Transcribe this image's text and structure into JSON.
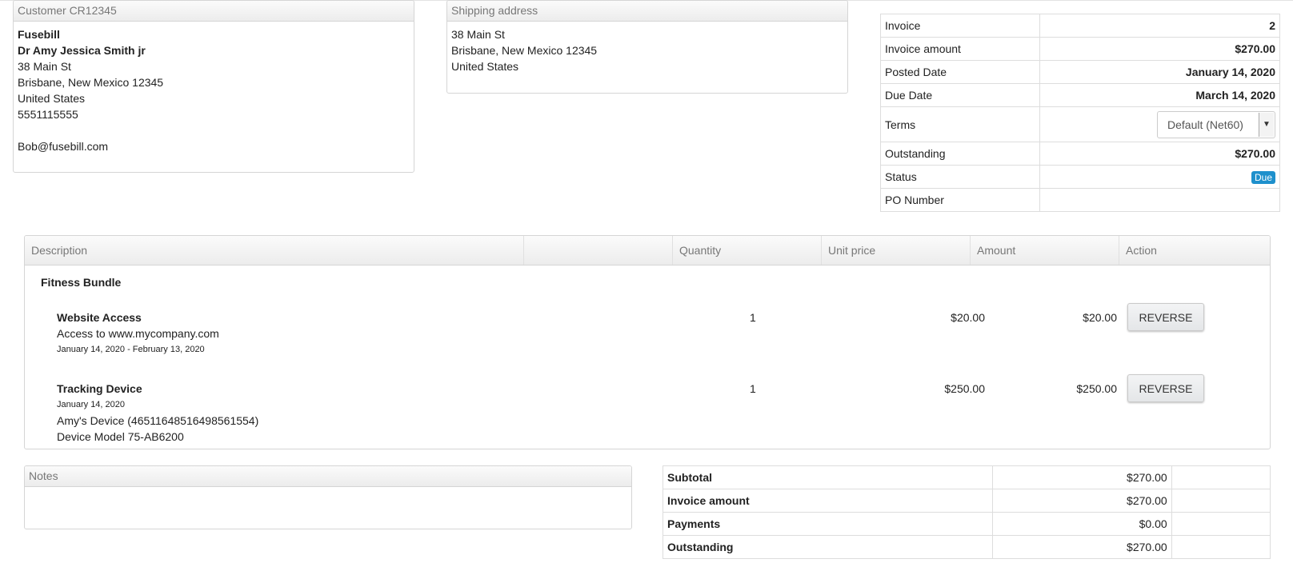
{
  "customer": {
    "header": "Customer CR12345",
    "company": "Fusebill",
    "name": "Dr Amy Jessica Smith jr",
    "street": "38 Main St",
    "city": "Brisbane, New Mexico 12345",
    "country": "United States",
    "phone": "5551115555",
    "email": "Bob@fusebill.com"
  },
  "shipping": {
    "header": "Shipping address",
    "street": "38 Main St",
    "city": "Brisbane, New Mexico 12345",
    "country": "United States"
  },
  "invoice": {
    "invoice_label": "Invoice",
    "invoice_value": "2",
    "amount_label": "Invoice amount",
    "amount_value": "$270.00",
    "posted_label": "Posted Date",
    "posted_value": "January 14, 2020",
    "due_label": "Due Date",
    "due_value": "March 14, 2020",
    "terms_label": "Terms",
    "terms_value": "Default (Net60)",
    "outstanding_label": "Outstanding",
    "outstanding_value": "$270.00",
    "status_label": "Status",
    "status_value": "Due",
    "po_label": "PO Number",
    "po_value": ""
  },
  "items": {
    "headers": [
      "Description",
      "",
      "Quantity",
      "Unit price",
      "Amount",
      "Action"
    ],
    "group": "Fitness Bundle",
    "rows": [
      {
        "name": "Website Access",
        "line1": "Access to www.mycompany.com",
        "date": "January 14, 2020 - February 13, 2020",
        "qty": "1",
        "price": "$20.00",
        "amount": "$20.00",
        "action": "REVERSE"
      },
      {
        "name": "Tracking Device",
        "date": "January 14, 2020",
        "line1": "Amy's Device (4651164851649856155­4)",
        "line2": "Device Model 75-AB6200",
        "qty": "1",
        "price": "$250.00",
        "amount": "$250.00",
        "action": "REVERSE"
      }
    ]
  },
  "notes": {
    "header": "Notes"
  },
  "summary": {
    "subtotal_label": "Subtotal",
    "subtotal_value": "$270.00",
    "amount_label": "Invoice amount",
    "amount_value": "$270.00",
    "payments_label": "Payments",
    "payments_value": "$0.00",
    "outstanding_label": "Outstanding",
    "outstanding_value": "$270.00"
  },
  "colors": {
    "status_badge": "#1e90cc",
    "border": "#d5d5d5"
  }
}
